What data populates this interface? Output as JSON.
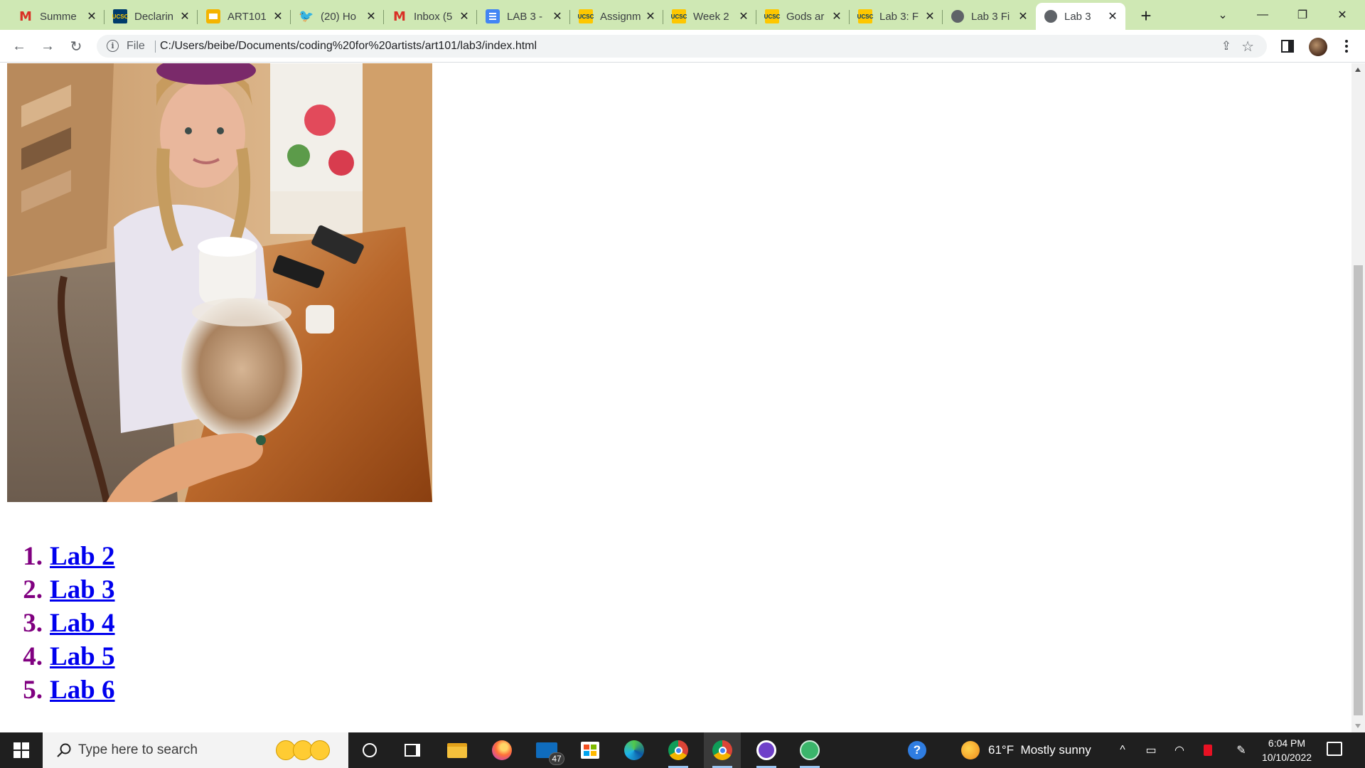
{
  "browser": {
    "tabs": [
      {
        "title": "Summe",
        "icon": "gmail-icon"
      },
      {
        "title": "Declarin",
        "icon": "ucsc-icon"
      },
      {
        "title": "ART101",
        "icon": "slides-icon"
      },
      {
        "title": "(20) Ho",
        "icon": "twitter-icon"
      },
      {
        "title": "Inbox (5",
        "icon": "gmail-icon"
      },
      {
        "title": "LAB 3 -",
        "icon": "docs-icon"
      },
      {
        "title": "Assignm",
        "icon": "ucsc-icon"
      },
      {
        "title": "Week 2",
        "icon": "ucsc-icon"
      },
      {
        "title": "Gods ar",
        "icon": "ucsc-icon"
      },
      {
        "title": "Lab 3: F",
        "icon": "ucsc-icon"
      },
      {
        "title": "Lab 3 Fi",
        "icon": "globe-icon"
      },
      {
        "title": "Lab 3",
        "icon": "globe-icon",
        "active": true
      }
    ],
    "favicon_text": {
      "gmail": "M",
      "ucsc": "UCSC",
      "twitter": "🐦"
    },
    "close_glyph": "✕",
    "new_tab_glyph": "+",
    "window_controls": {
      "tab_search": "⌄",
      "minimize": "—",
      "restore": "❐",
      "close": "✕"
    },
    "toolbar": {
      "back": "←",
      "forward": "→",
      "reload": "↻",
      "info_glyph": "i",
      "scheme_label": "File",
      "url": "C:/Users/beibe/Documents/coding%20for%20artists/art101/lab3/index.html",
      "share_glyph": "⇪",
      "star_glyph": "☆"
    },
    "colors": {
      "tabstrip": "#cfe8b4",
      "link": "#0000ee",
      "list_marker": "#800080"
    }
  },
  "page": {
    "photo_alt": "photo",
    "lab_list": [
      {
        "number": "1.",
        "label": "Lab 2"
      },
      {
        "number": "2.",
        "label": "Lab 3"
      },
      {
        "number": "3.",
        "label": "Lab 4"
      },
      {
        "number": "4.",
        "label": "Lab 5"
      },
      {
        "number": "5.",
        "label": "Lab 6"
      }
    ]
  },
  "taskbar": {
    "search_placeholder": "Type here to search",
    "mail_badge": "47",
    "help_glyph": "?",
    "weather": {
      "temp": "61°F",
      "condition": "Mostly sunny"
    },
    "tray": {
      "chevron": "^",
      "meet": "▭",
      "wifi": "◠",
      "pen": "✎"
    },
    "clock": {
      "time": "6:04 PM",
      "date": "10/10/2022"
    }
  }
}
